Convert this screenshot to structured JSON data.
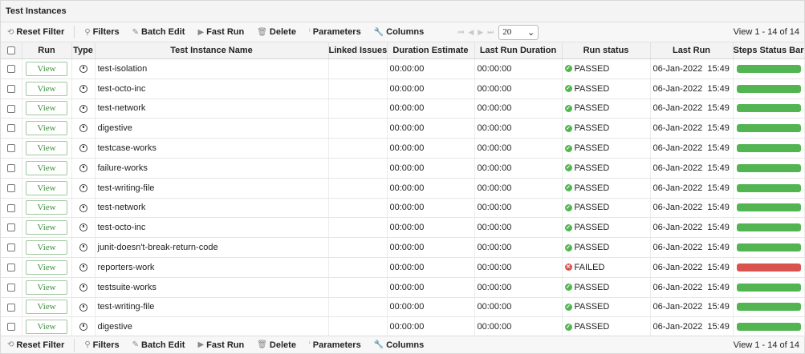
{
  "title": "Test Instances",
  "toolbar": {
    "reset_filter": "Reset Filter",
    "filters": "Filters",
    "batch_edit": "Batch Edit",
    "fast_run": "Fast Run",
    "delete": "Delete",
    "parameters": "Parameters",
    "columns": "Columns",
    "page_size": "20",
    "view_count": "View 1 - 14 of 14"
  },
  "columns": [
    "Run",
    "Type",
    "Test Instance Name",
    "Linked Issues",
    "Duration Estimate",
    "Last Run Duration",
    "Run status",
    "Last Run",
    "Steps Status Bar"
  ],
  "colors": {
    "passed": "#52b552",
    "failed": "#d9534f"
  },
  "rows": [
    {
      "view": "View",
      "name": "test-isolation",
      "linked": "",
      "duration_estimate": "00:00:00",
      "last_run_duration": "00:00:00",
      "status": "PASSED",
      "last_run": "06-Jan-2022  15:49",
      "bar_status": "passed"
    },
    {
      "view": "View",
      "name": "test-octo-inc",
      "linked": "",
      "duration_estimate": "00:00:00",
      "last_run_duration": "00:00:00",
      "status": "PASSED",
      "last_run": "06-Jan-2022  15:49",
      "bar_status": "passed"
    },
    {
      "view": "View",
      "name": "test-network",
      "linked": "",
      "duration_estimate": "00:00:00",
      "last_run_duration": "00:00:00",
      "status": "PASSED",
      "last_run": "06-Jan-2022  15:49",
      "bar_status": "passed"
    },
    {
      "view": "View",
      "name": "digestive",
      "linked": "",
      "duration_estimate": "00:00:00",
      "last_run_duration": "00:00:00",
      "status": "PASSED",
      "last_run": "06-Jan-2022  15:49",
      "bar_status": "passed"
    },
    {
      "view": "View",
      "name": "testcase-works",
      "linked": "",
      "duration_estimate": "00:00:00",
      "last_run_duration": "00:00:00",
      "status": "PASSED",
      "last_run": "06-Jan-2022  15:49",
      "bar_status": "passed"
    },
    {
      "view": "View",
      "name": "failure-works",
      "linked": "",
      "duration_estimate": "00:00:00",
      "last_run_duration": "00:00:00",
      "status": "PASSED",
      "last_run": "06-Jan-2022  15:49",
      "bar_status": "passed"
    },
    {
      "view": "View",
      "name": "test-writing-file",
      "linked": "",
      "duration_estimate": "00:00:00",
      "last_run_duration": "00:00:00",
      "status": "PASSED",
      "last_run": "06-Jan-2022  15:49",
      "bar_status": "passed"
    },
    {
      "view": "View",
      "name": "test-network",
      "linked": "",
      "duration_estimate": "00:00:00",
      "last_run_duration": "00:00:00",
      "status": "PASSED",
      "last_run": "06-Jan-2022  15:49",
      "bar_status": "passed"
    },
    {
      "view": "View",
      "name": "test-octo-inc",
      "linked": "",
      "duration_estimate": "00:00:00",
      "last_run_duration": "00:00:00",
      "status": "PASSED",
      "last_run": "06-Jan-2022  15:49",
      "bar_status": "passed"
    },
    {
      "view": "View",
      "name": "junit-doesn't-break-return-code",
      "linked": "",
      "duration_estimate": "00:00:00",
      "last_run_duration": "00:00:00",
      "status": "PASSED",
      "last_run": "06-Jan-2022  15:49",
      "bar_status": "passed"
    },
    {
      "view": "View",
      "name": "reporters-work",
      "linked": "",
      "duration_estimate": "00:00:00",
      "last_run_duration": "00:00:00",
      "status": "FAILED",
      "last_run": "06-Jan-2022  15:49",
      "bar_status": "failed"
    },
    {
      "view": "View",
      "name": "testsuite-works",
      "linked": "",
      "duration_estimate": "00:00:00",
      "last_run_duration": "00:00:00",
      "status": "PASSED",
      "last_run": "06-Jan-2022  15:49",
      "bar_status": "passed"
    },
    {
      "view": "View",
      "name": "test-writing-file",
      "linked": "",
      "duration_estimate": "00:00:00",
      "last_run_duration": "00:00:00",
      "status": "PASSED",
      "last_run": "06-Jan-2022  15:49",
      "bar_status": "passed"
    },
    {
      "view": "View",
      "name": "digestive",
      "linked": "",
      "duration_estimate": "00:00:00",
      "last_run_duration": "00:00:00",
      "status": "PASSED",
      "last_run": "06-Jan-2022  15:49",
      "bar_status": "passed"
    }
  ]
}
